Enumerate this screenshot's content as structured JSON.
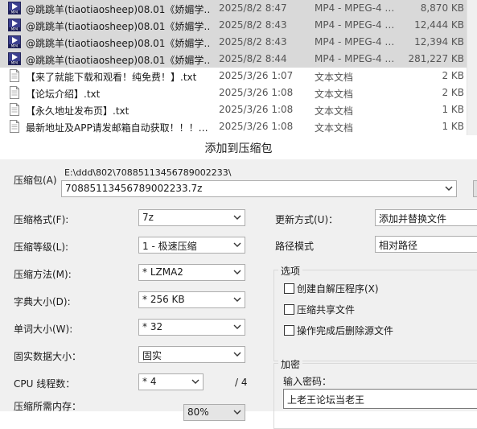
{
  "file_list": {
    "rows": [
      {
        "name": "@跳跳羊(tiaotiaosheep)08.01《娇媚学…",
        "date": "2025/8/2 8:47",
        "type": "MP4 - MPEG-4 …",
        "size": "8,870 KB",
        "icon": "mp4-video-icon"
      },
      {
        "name": "@跳跳羊(tiaotiaosheep)08.01《娇媚学…",
        "date": "2025/8/2 8:43",
        "type": "MP4 - MPEG-4 …",
        "size": "12,444 KB",
        "icon": "mp4-video-icon"
      },
      {
        "name": "@跳跳羊(tiaotiaosheep)08.01《娇媚学…",
        "date": "2025/8/2 8:43",
        "type": "MP4 - MPEG-4 …",
        "size": "12,394 KB",
        "icon": "mp4-video-icon"
      },
      {
        "name": "@跳跳羊(tiaotiaosheep)08.01《娇媚学…",
        "date": "2025/8/2 8:44",
        "type": "MP4 - MPEG-4 …",
        "size": "281,227 KB",
        "icon": "mp4-video-icon"
      },
      {
        "name": "【来了就能下载和观看！纯免费！】.txt",
        "date": "2025/3/26 1:07",
        "type": "文本文档",
        "size": "2 KB",
        "icon": "text-file-icon"
      },
      {
        "name": "【论坛介绍】.txt",
        "date": "2025/3/26 1:08",
        "type": "文本文档",
        "size": "2 KB",
        "icon": "text-file-icon"
      },
      {
        "name": "【永久地址发布页】.txt",
        "date": "2025/3/26 1:08",
        "type": "文本文档",
        "size": "1 KB",
        "icon": "text-file-icon"
      },
      {
        "name": "最新地址及APP请发邮箱自动获取！！！…",
        "date": "2025/3/26 1:08",
        "type": "文本文档",
        "size": "1 KB",
        "icon": "text-file-icon"
      }
    ]
  },
  "dialog": {
    "title": "添加到压缩包",
    "archive_label": "压缩包(A)",
    "archive_path": "E:\\ddd\\802\\70885113456789002233\\",
    "archive_name": "70885113456789002233.7z",
    "fields": {
      "format_label": "压缩格式(F):",
      "format_value": "7z",
      "level_label": "压缩等级(L):",
      "level_value": "1 - 极速压缩",
      "method_label": "压缩方法(M):",
      "method_value": "* LZMA2",
      "dict_label": "字典大小(D):",
      "dict_value": "* 256 KB",
      "word_label": "单词大小(W):",
      "word_value": "* 32",
      "solid_label": "固实数据大小：",
      "solid_value": "固实",
      "cpu_label": "CPU 线程数：",
      "cpu_value": "* 4",
      "cpu_total": "/ 4",
      "memory_label": "压缩所需内存：",
      "memory_value": "80%"
    },
    "update_label": "更新方式(U)：",
    "update_value": "添加并替换文件",
    "path_label": "路径模式",
    "path_value": "相对路径",
    "options": {
      "title": "选项",
      "items": [
        "创建自解压程序(X)",
        "压缩共享文件",
        "操作完成后删除源文件"
      ],
      "checked": [
        false,
        false,
        false
      ]
    },
    "encryption": {
      "title": "加密",
      "password_label": "输入密码：",
      "password_value": "上老王论坛当老王"
    }
  }
}
